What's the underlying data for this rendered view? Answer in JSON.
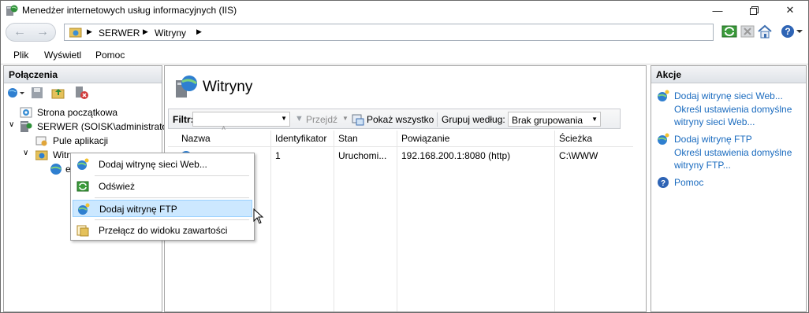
{
  "window": {
    "title": "Menedżer internetowych usług informacyjnych (IIS)"
  },
  "address": {
    "crumbs": [
      "SERWER",
      "Witryny"
    ]
  },
  "menu": {
    "items": [
      "Plik",
      "Wyświetl",
      "Pomoc"
    ]
  },
  "connections": {
    "title": "Połączenia",
    "tree": [
      {
        "label": "Strona początkowa"
      },
      {
        "label": "SERWER (SOISK\\administrator"
      },
      {
        "label": "Pule aplikacji"
      },
      {
        "label": "Witryny"
      },
      {
        "label": "e"
      }
    ]
  },
  "center": {
    "title": "Witryny",
    "filter_label": "Filtr:",
    "go_label": "Przejdź",
    "show_all_label": "Pokaż wszystko",
    "group_label": "Grupuj według:",
    "group_value": "Brak grupowania",
    "columns": [
      "Nazwa",
      "Identyfikator",
      "Stan",
      "Powiązanie",
      "Ścieżka"
    ],
    "rows": [
      {
        "id": "1",
        "state": "Uruchomi...",
        "binding": "192.168.200.1:8080 (http)",
        "path": "C:\\WWW"
      }
    ]
  },
  "actions": {
    "title": "Akcje",
    "add_web": "Dodaj witrynę sieci Web...",
    "web_defaults_1": "Określ ustawienia domyślne",
    "web_defaults_2": "witryny sieci Web...",
    "add_ftp": "Dodaj witrynę FTP",
    "ftp_defaults_1": "Określ ustawienia domyślne",
    "ftp_defaults_2": "witryny FTP...",
    "help": "Pomoc"
  },
  "context_menu": {
    "items": [
      "Dodaj witrynę sieci Web...",
      "Odśwież",
      "Dodaj witrynę FTP",
      "Przełącz do widoku zawartości"
    ]
  },
  "colors": {
    "link": "#1a6bbf",
    "hover": "#cce8ff",
    "selection": "#cce8ff"
  }
}
